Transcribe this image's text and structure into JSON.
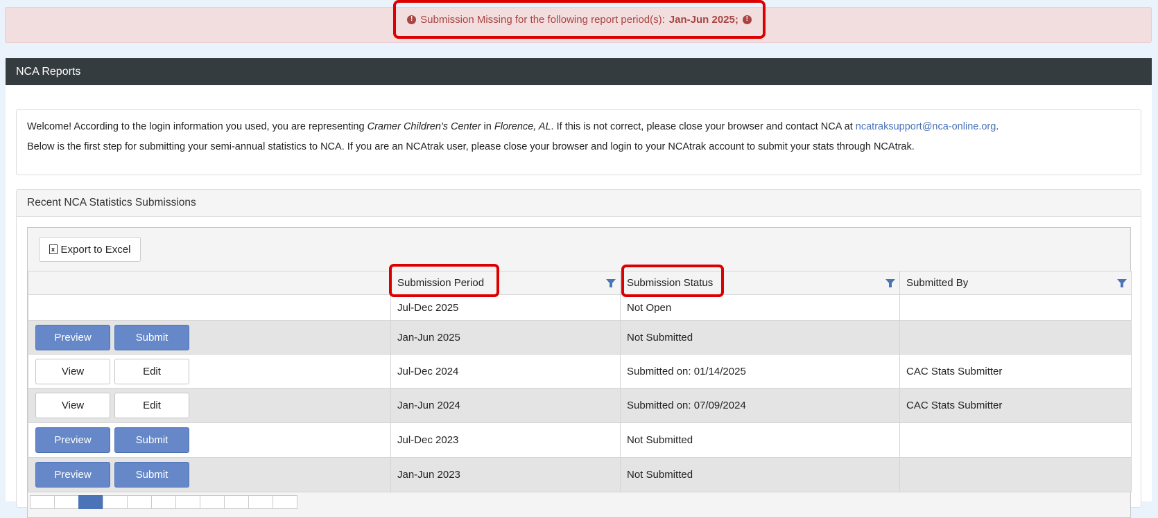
{
  "alert": {
    "message": "Submission Missing for the following report period(s):",
    "periods": "Jan-Jun 2025;",
    "icon": "exclamation-circle-icon"
  },
  "panel": {
    "title": "NCA Reports"
  },
  "welcome": {
    "line1_a": "Welcome! According to the login information you used, you are representing ",
    "organization": "Cramer Children's Center",
    "line1_b": " in ",
    "location": "Florence, AL",
    "line1_c": ". If this is not correct, please close your browser and contact NCA at ",
    "email": "ncatraksupport@nca-online.org",
    "line1_d": ".",
    "line2": "Below is the first step for submitting your semi-annual statistics to NCA. If you are an NCAtrak user, please close your browser and login to your NCAtrak account to submit your stats through NCAtrak."
  },
  "recent": {
    "title": "Recent NCA Statistics Submissions",
    "export_label": "Export to Excel",
    "columns": [
      "",
      "Submission Period",
      "Submission Status",
      "Submitted By"
    ],
    "rows": [
      {
        "actions": [],
        "period": "Jul-Dec 2025",
        "status": "Not Open",
        "by": ""
      },
      {
        "actions": [
          "Preview",
          "Submit"
        ],
        "period": "Jan-Jun 2025",
        "status": "Not Submitted",
        "by": ""
      },
      {
        "actions": [
          "View",
          "Edit"
        ],
        "period": "Jul-Dec 2024",
        "status": "Submitted on: 01/14/2025",
        "by": "CAC Stats Submitter"
      },
      {
        "actions": [
          "View",
          "Edit"
        ],
        "period": "Jan-Jun 2024",
        "status": "Submitted on: 07/09/2024",
        "by": "CAC Stats Submitter"
      },
      {
        "actions": [
          "Preview",
          "Submit"
        ],
        "period": "Jul-Dec 2023",
        "status": "Not Submitted",
        "by": ""
      },
      {
        "actions": [
          "Preview",
          "Submit"
        ],
        "period": "Jan-Jun 2023",
        "status": "Not Submitted",
        "by": ""
      }
    ]
  },
  "colors": {
    "header_bg": "#353c3f",
    "primary_button": "#6688c8",
    "alert_bg": "#f2dede",
    "highlight": "#dd0000"
  }
}
